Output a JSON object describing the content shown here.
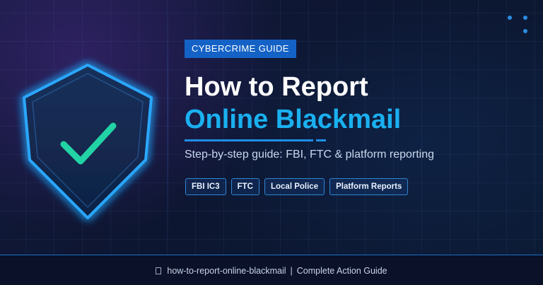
{
  "badge": "CYBERCRIME GUIDE",
  "title": {
    "line1": "How to Report",
    "line2": "Online Blackmail"
  },
  "subtitle": "Step-by-step guide: FBI, FTC & platform reporting",
  "tags": [
    "FBI IC3",
    "FTC",
    "Local Police",
    "Platform Reports"
  ],
  "footer": {
    "slug": "how-to-report-online-blackmail",
    "separator": "|",
    "tagline": "Complete Action Guide"
  },
  "icons": {
    "shield": "shield-check-icon",
    "footer": "link-icon"
  },
  "colors": {
    "accent": "#1ab0f0",
    "badge_bg": "#1462c6",
    "check": "#22d3a6",
    "shield_glow": "#2aa7ff"
  }
}
